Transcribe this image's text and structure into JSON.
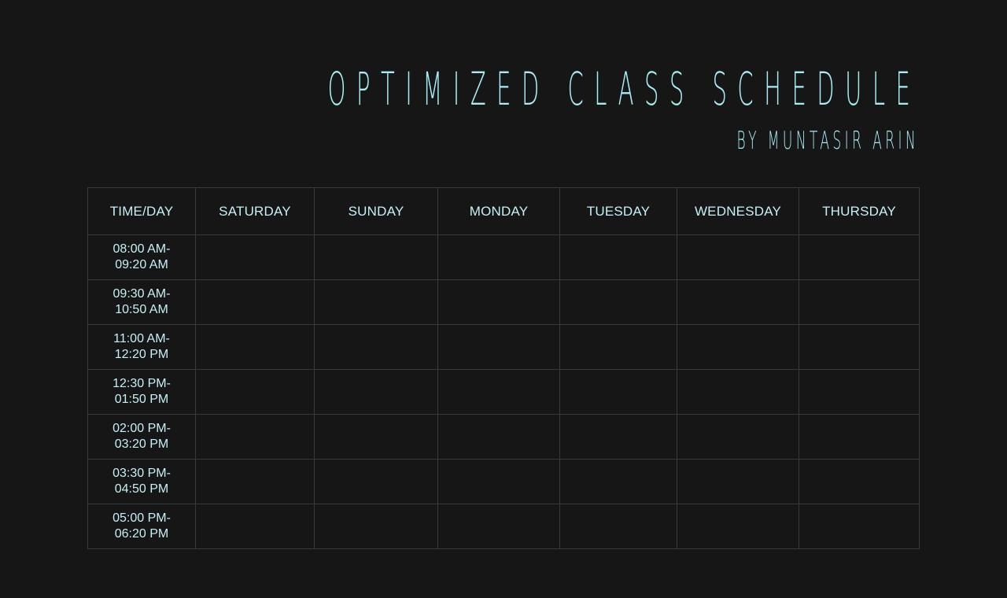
{
  "header": {
    "title": "OPTIMIZED CLASS SCHEDULE",
    "subtitle": "BY MUNTASIR ARIN"
  },
  "table": {
    "columns": [
      "TIME/DAY",
      "SATURDAY",
      "SUNDAY",
      "MONDAY",
      "TUESDAY",
      "WEDNESDAY",
      "THURSDAY"
    ],
    "rows": [
      {
        "start": "08:00 AM-",
        "end": "09:20 AM"
      },
      {
        "start": "09:30 AM-",
        "end": "10:50 AM"
      },
      {
        "start": "11:00 AM-",
        "end": "12:20 PM"
      },
      {
        "start": "12:30 PM-",
        "end": "01:50 PM"
      },
      {
        "start": "02:00 PM-",
        "end": "03:20 PM"
      },
      {
        "start": "03:30 PM-",
        "end": "04:50 PM"
      },
      {
        "start": "05:00 PM-",
        "end": "06:20 PM"
      }
    ]
  },
  "colors": {
    "background": "#161616",
    "accent": "#a6ecf6",
    "grid": "#353b3c"
  }
}
